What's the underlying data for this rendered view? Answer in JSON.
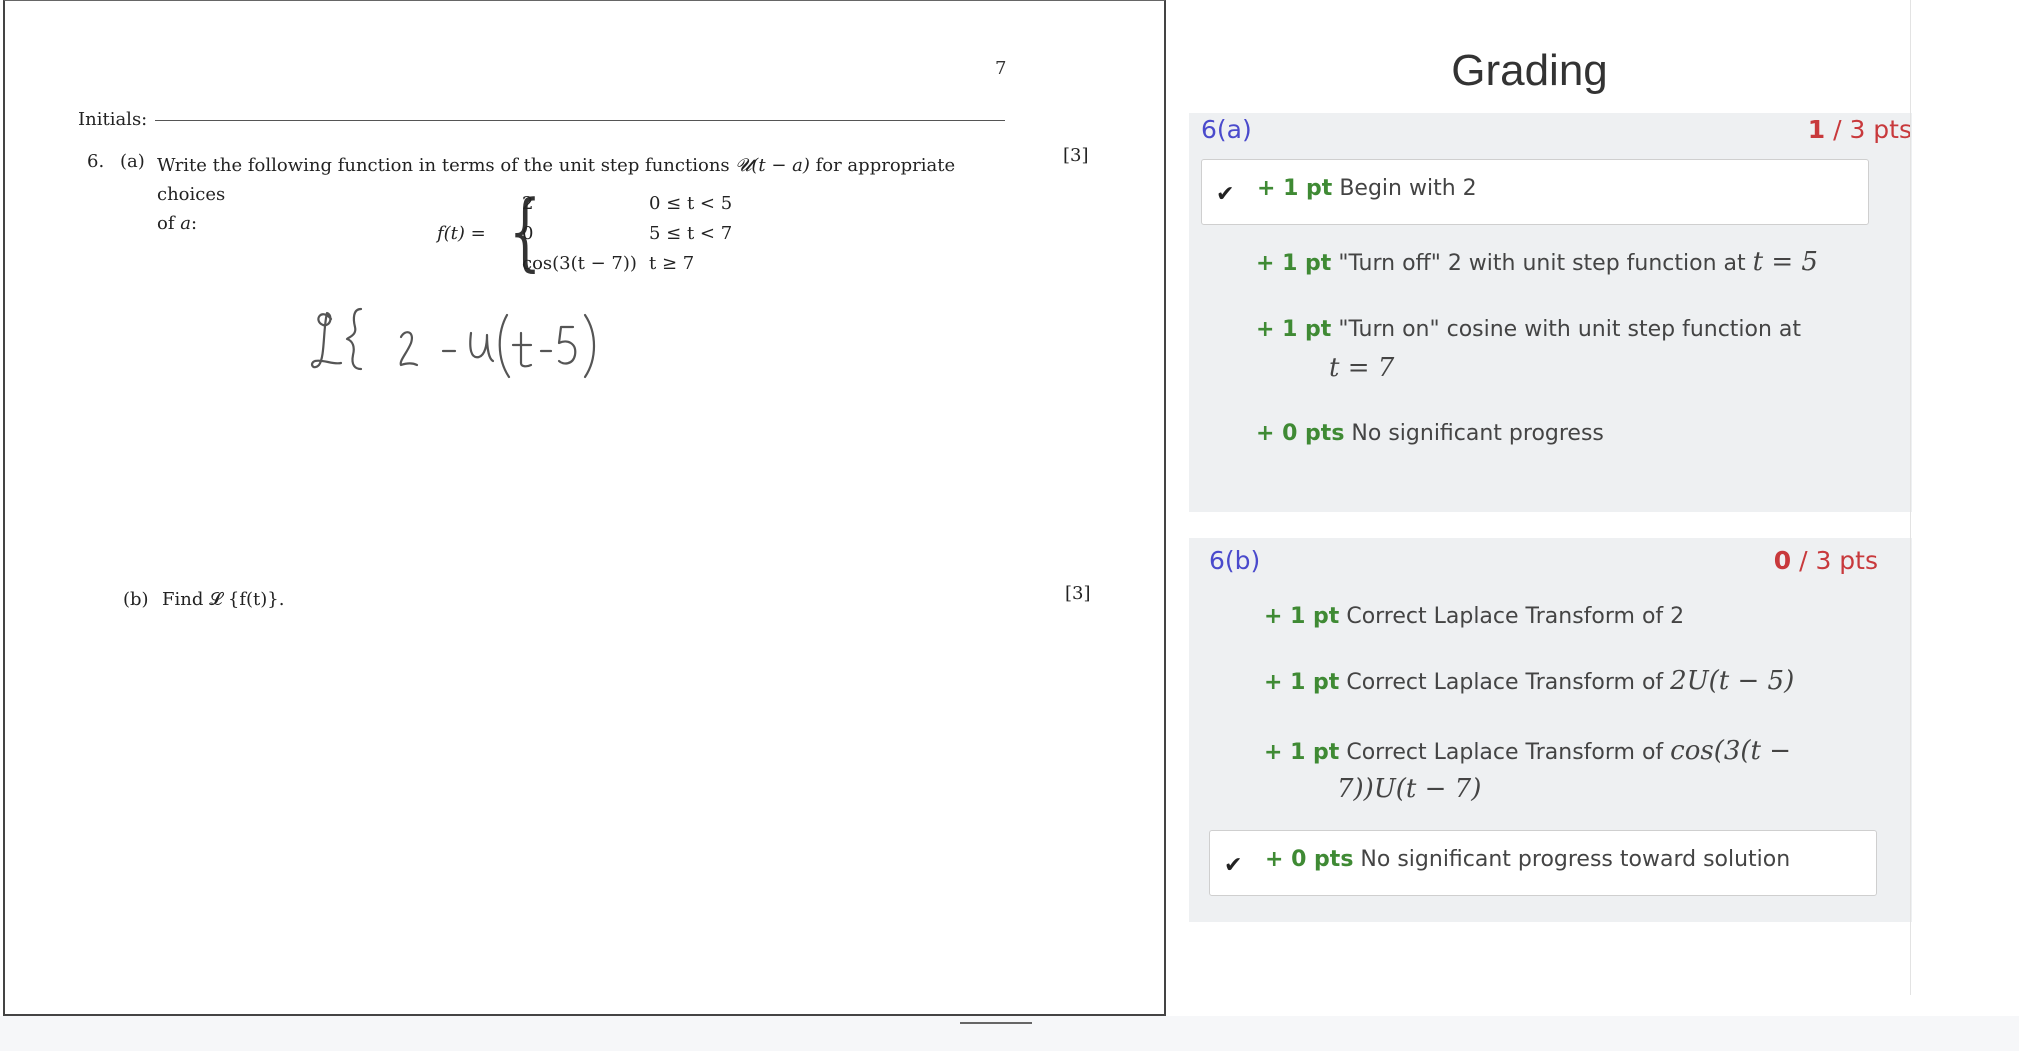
{
  "exam": {
    "page_number": "7",
    "initials_label": "Initials:",
    "question_number": "6.",
    "part_a": {
      "letter": "(a)",
      "text_line1": "Write the following function in terms of the unit step functions",
      "text_func": "𝓤(t − a)",
      "text_line1_end": "for appropriate choices",
      "text_line2": "of",
      "text_var": "a",
      "text_colon": ":",
      "marks": "[3]",
      "function_lhs": "f(t) =",
      "cases": [
        {
          "value": "2",
          "condition": "0 ≤ t < 5"
        },
        {
          "value": "0",
          "condition": "5 ≤ t < 7"
        },
        {
          "value": "cos(3(t − 7))",
          "condition": "t ≥ 7"
        }
      ]
    },
    "part_b": {
      "letter": "(b)",
      "text": "Find 𝓛 {f(t)}.",
      "marks": "[3]"
    },
    "handwritten_answer": "𝓛{ 2 - u(t - 5)"
  },
  "grading": {
    "title": "Grading",
    "questions": [
      {
        "label": "6(a)",
        "score": "1",
        "score_rest": " / 3 pts",
        "items": [
          {
            "points": "+ 1 pt",
            "text": "Begin with 2",
            "selected": true
          },
          {
            "points": "+ 1 pt",
            "text": "\"Turn off\" 2 with unit step function at",
            "math": "t = 5",
            "selected": false
          },
          {
            "points": "+ 1 pt",
            "text": "\"Turn on\" cosine with unit step function at",
            "math": "t = 7",
            "selected": false
          },
          {
            "points": "+ 0 pts",
            "text": "No significant progress",
            "selected": false
          }
        ]
      },
      {
        "label": "6(b)",
        "score": "0",
        "score_rest": " / 3 pts",
        "items": [
          {
            "points": "+ 1 pt",
            "text": "Correct Laplace Transform of 2",
            "selected": false
          },
          {
            "points": "+ 1 pt",
            "text": "Correct Laplace Transform of",
            "math": "2U(t − 5)",
            "selected": false
          },
          {
            "points": "+ 1 pt",
            "text": "Correct Laplace Transform of",
            "math": "cos(3(t −",
            "math2": "7))U(t − 7)",
            "selected": false
          },
          {
            "points": "+ 0 pts",
            "text": "No significant progress toward solution",
            "selected": true
          }
        ]
      }
    ]
  },
  "colors": {
    "question_label": "#4a4acc",
    "score": "#c8393c",
    "points": "#3f8a34",
    "section_bg": "#eef0f2"
  }
}
